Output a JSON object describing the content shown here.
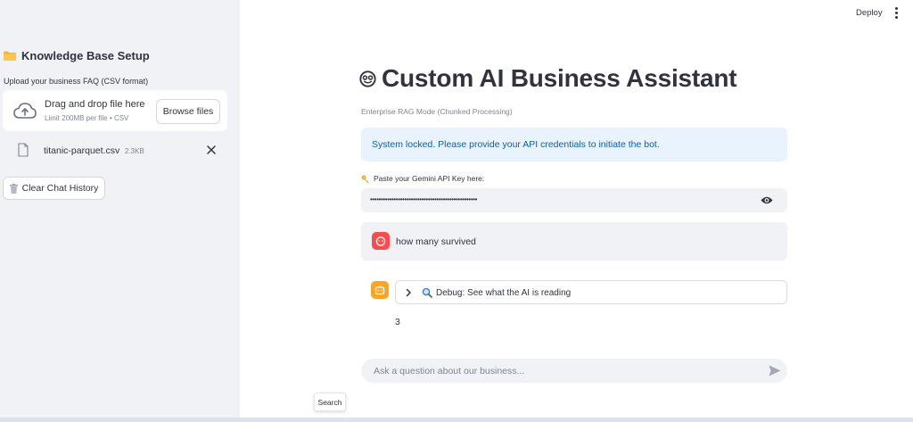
{
  "sidebar": {
    "title": "Knowledge Base Setup",
    "upload_label": "Upload your business FAQ (CSV format)",
    "dropzone": {
      "title": "Drag and drop file here",
      "subtitle": "Limit 200MB per file • CSV",
      "browse_label": "Browse files"
    },
    "file": {
      "name": "titanic-parquet.csv",
      "size": "2.3KB"
    },
    "clear_label": "Clear Chat History"
  },
  "header": {
    "deploy_label": "Deploy"
  },
  "main": {
    "title": "Custom AI Business Assistant",
    "caption": "Enterprise RAG Mode (Chunked Processing)",
    "alert": "System locked. Please provide your API credentials to initiate the bot.",
    "api_label": "Paste your Gemini API Key here:",
    "api_value": "••••••••••••••••••••••••••••••••••••••••••••••••••",
    "messages": {
      "user_text": "how many survived",
      "debug_label": "Debug: See what the AI is reading",
      "bot_answer": "3"
    },
    "chat_placeholder": "Ask a question about our business...",
    "tooltip": "Search"
  },
  "colors": {
    "sidebar_bg": "#f0f2f6",
    "alert_bg": "#e8f3fd",
    "alert_text": "#0f5ea8",
    "user_avatar": "#ff4b4b",
    "bot_avatar": "#ffa421"
  },
  "icons": {
    "sidebar_title": "folder-icon",
    "dropzone": "cloud-upload-icon",
    "file": "file-icon",
    "remove": "close-icon",
    "clear": "trash-icon",
    "menu": "kebab-menu-icon",
    "title": "bot-face-icon",
    "api_label": "key-icon",
    "visibility": "eye-icon",
    "user": "user-avatar-icon",
    "bot": "bot-avatar-icon",
    "expander": "chevron-right-icon",
    "debug": "magnifier-icon",
    "send": "send-icon"
  }
}
